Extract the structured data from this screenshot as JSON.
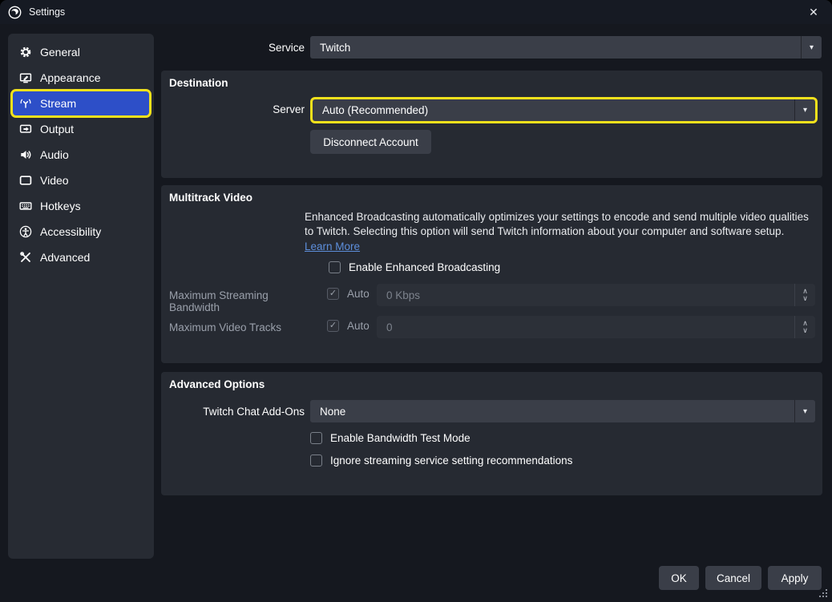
{
  "window": {
    "title": "Settings"
  },
  "icons": {
    "close": "✕",
    "dropdown_arrow": "▾",
    "check": "✓",
    "spinner_up": "∧",
    "spinner_down": "∨"
  },
  "colors": {
    "accent_blue": "#2d4fc8",
    "highlight_yellow": "#f2e11c",
    "link_blue": "#5d8fdc",
    "panel": "#262a32"
  },
  "sidebar": {
    "items": [
      {
        "label": "General"
      },
      {
        "label": "Appearance"
      },
      {
        "label": "Stream",
        "selected": true
      },
      {
        "label": "Output"
      },
      {
        "label": "Audio"
      },
      {
        "label": "Video"
      },
      {
        "label": "Hotkeys"
      },
      {
        "label": "Accessibility"
      },
      {
        "label": "Advanced"
      }
    ]
  },
  "service_row": {
    "label": "Service",
    "value": "Twitch"
  },
  "sections": {
    "destination": {
      "title": "Destination",
      "server_label": "Server",
      "server_value": "Auto (Recommended)",
      "disconnect_button": "Disconnect Account"
    },
    "multitrack": {
      "title": "Multitrack Video",
      "description": "Enhanced Broadcasting automatically optimizes your settings to encode and send multiple video qualities to Twitch. Selecting this option will send Twitch information about your computer and software setup.",
      "learn_more": "Learn More",
      "enable_checkbox": "Enable Enhanced Broadcasting",
      "bandwidth_label": "Maximum Streaming Bandwidth",
      "auto_label": "Auto",
      "bandwidth_value": "0 Kbps",
      "tracks_label": "Maximum Video Tracks",
      "tracks_value": "0"
    },
    "advanced": {
      "title": "Advanced Options",
      "chat_addons_label": "Twitch Chat Add-Ons",
      "chat_addons_value": "None",
      "bandwidth_test_checkbox": "Enable Bandwidth Test Mode",
      "ignore_checkbox": "Ignore streaming service setting recommendations"
    }
  },
  "footer": {
    "ok": "OK",
    "cancel": "Cancel",
    "apply": "Apply"
  }
}
